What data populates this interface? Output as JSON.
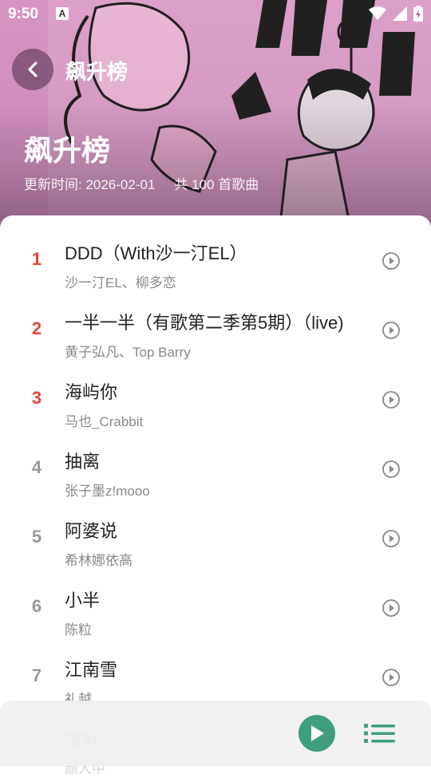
{
  "status_bar": {
    "time": "9:50",
    "notification_label": "A"
  },
  "header": {
    "nav_title": "飙升榜",
    "title": "飙升榜",
    "update_time": "更新时间: 2026-02-01",
    "song_count": "共 100 首歌曲"
  },
  "songs": [
    {
      "rank": "1",
      "title": "DDD（With沙一汀EL）",
      "artist": "沙一汀EL、柳多恋"
    },
    {
      "rank": "2",
      "title": "一半一半（有歌第二季第5期）（live)",
      "artist": "黄子弘凡、Top Barry"
    },
    {
      "rank": "3",
      "title": "海屿你",
      "artist": "马也_Crabbit"
    },
    {
      "rank": "4",
      "title": "抽离",
      "artist": "张子墨z!mooo"
    },
    {
      "rank": "5",
      "title": "阿婆说",
      "artist": "希林娜依高"
    },
    {
      "rank": "6",
      "title": "小半",
      "artist": "陈粒"
    },
    {
      "rank": "7",
      "title": "江南雪",
      "artist": "礼越"
    },
    {
      "rank": "8",
      "title": "嗜好",
      "artist": "颜人中"
    }
  ],
  "colors": {
    "top_rank": "#e8443a",
    "accent": "#3f9e80",
    "header_pink": "#e8a3cf"
  },
  "icons": {
    "back": "chevron-left-icon",
    "play": "play-circle-icon",
    "player_play": "play-icon",
    "playlist": "playlist-icon"
  }
}
